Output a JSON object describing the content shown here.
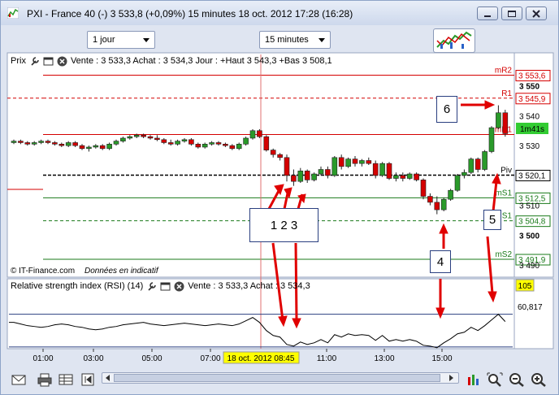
{
  "window": {
    "title": "PXI - France 40 (-)   3 533,8 (+0,09%)   15 minutes   18 oct. 2012 17:28 (16:28)"
  },
  "toolbar": {
    "period_select": "1 jour",
    "interval_select": "15 minutes"
  },
  "price_panel": {
    "name": "Prix",
    "info": "Vente : 3 533,3 Achat : 3 534,3 Jour : +Haut 3 543,3 +Bas 3 508,1",
    "copyright": "© IT-Finance.com",
    "disclaimer": "Données en indicatif",
    "timer": "1m41s"
  },
  "rsi_panel": {
    "name": "Relative strength index (RSI) (14)",
    "info": "Vente : 3 533,3 Achat : 3 534,3",
    "top_tag": "105",
    "value_label": "60,817"
  },
  "x_axis": {
    "labels": [
      "01:00",
      "03:00",
      "05:00",
      "07:00",
      "11:00",
      "13:00",
      "15:00"
    ],
    "cursor_label": "18 oct. 2012 08:45"
  },
  "annotations": {
    "box_123": "1 2 3",
    "box_4": "4",
    "box_5": "5",
    "box_6": "6"
  },
  "chart_data": {
    "type": "candlestick",
    "y_range": [
      3487,
      3560
    ],
    "y_ticks": [
      {
        "value": 3550,
        "label": "3 550",
        "bold": true
      },
      {
        "value": 3540,
        "label": "3 540",
        "bold": false
      },
      {
        "value": 3530,
        "label": "3 530",
        "bold": false
      },
      {
        "value": 3510,
        "label": "3 510",
        "bold": false
      },
      {
        "value": 3500,
        "label": "3 500",
        "bold": true
      },
      {
        "value": 3490,
        "label": "3 490",
        "bold": false
      }
    ],
    "levels": [
      {
        "name": "mR2",
        "value": 3553.6,
        "label": "3 553,6",
        "color": "#d40000",
        "style": "solid"
      },
      {
        "name": "R1",
        "value": 3545.9,
        "label": "3 545,9",
        "color": "#d40000",
        "style": "dashed"
      },
      {
        "name": "mR1",
        "value": 3533.7,
        "label": "",
        "color": "#d40000",
        "style": "solid"
      },
      {
        "name": "Piv",
        "value": 3520.1,
        "label": "3 520,1",
        "color": "#000000",
        "style": "dashed"
      },
      {
        "name": "mS1",
        "value": 3512.5,
        "label": "3 512,5",
        "color": "#1a7a1a",
        "style": "solid"
      },
      {
        "name": "S1",
        "value": 3504.8,
        "label": "3 504,8",
        "color": "#1a7a1a",
        "style": "dashed"
      },
      {
        "name": "mS2",
        "value": 3491.9,
        "label": "3 491,9",
        "color": "#1a7a1a",
        "style": "solid"
      }
    ],
    "current_price": 3533.3,
    "candles": [
      [
        3531,
        3532,
        3530.5,
        3531.5
      ],
      [
        3531.5,
        3532,
        3530.5,
        3531
      ],
      [
        3531,
        3531.5,
        3530,
        3530.5
      ],
      [
        3530.5,
        3531.5,
        3530,
        3531
      ],
      [
        3531,
        3532,
        3530.5,
        3531.5
      ],
      [
        3531.5,
        3532,
        3530.5,
        3531
      ],
      [
        3531,
        3531.5,
        3530,
        3530.5
      ],
      [
        3530.5,
        3531,
        3529.5,
        3530
      ],
      [
        3530,
        3531.5,
        3529.5,
        3531
      ],
      [
        3531,
        3531.5,
        3529.5,
        3530
      ],
      [
        3530,
        3530.5,
        3528.5,
        3529
      ],
      [
        3529,
        3530,
        3528,
        3529.5
      ],
      [
        3529.5,
        3530.5,
        3529,
        3530
      ],
      [
        3530,
        3530.5,
        3528.5,
        3529
      ],
      [
        3529,
        3531,
        3528.5,
        3530.5
      ],
      [
        3530.5,
        3532,
        3530,
        3531.5
      ],
      [
        3531.5,
        3533,
        3531,
        3532.5
      ],
      [
        3532.5,
        3533.5,
        3532,
        3533
      ],
      [
        3533,
        3534,
        3532.5,
        3533.5
      ],
      [
        3533.5,
        3534,
        3532.5,
        3533
      ],
      [
        3533,
        3533.5,
        3532,
        3532.5
      ],
      [
        3532.5,
        3533.5,
        3531.5,
        3532
      ],
      [
        3532,
        3532.5,
        3530.5,
        3531
      ],
      [
        3531,
        3532,
        3530,
        3530.5
      ],
      [
        3530.5,
        3532,
        3530,
        3531.5
      ],
      [
        3531.5,
        3532.5,
        3531,
        3532
      ],
      [
        3532,
        3532.5,
        3530,
        3530.5
      ],
      [
        3530.5,
        3531,
        3529,
        3529.5
      ],
      [
        3529.5,
        3531,
        3529,
        3530.5
      ],
      [
        3530.5,
        3531.5,
        3530,
        3531
      ],
      [
        3531,
        3531.5,
        3530,
        3530.5
      ],
      [
        3530.5,
        3531,
        3529.5,
        3530
      ],
      [
        3530,
        3530.5,
        3528.5,
        3529
      ],
      [
        3529,
        3531,
        3528.5,
        3530.5
      ],
      [
        3530.5,
        3533,
        3530,
        3532.5
      ],
      [
        3532.5,
        3535.5,
        3532,
        3535
      ],
      [
        3535,
        3535.5,
        3532.5,
        3533
      ],
      [
        3533,
        3533.5,
        3528,
        3528.5
      ],
      [
        3528.5,
        3529,
        3526,
        3527
      ],
      [
        3527,
        3527.5,
        3525,
        3526
      ],
      [
        3526,
        3527,
        3518,
        3520
      ],
      [
        3520,
        3522,
        3516.5,
        3518
      ],
      [
        3518,
        3522.5,
        3517.5,
        3521.5
      ],
      [
        3521.5,
        3522,
        3517.5,
        3518.5
      ],
      [
        3518.5,
        3521,
        3518,
        3520.5
      ],
      [
        3520.5,
        3523,
        3520,
        3522
      ],
      [
        3522,
        3523,
        3519,
        3520
      ],
      [
        3520,
        3526.5,
        3519.5,
        3526
      ],
      [
        3526,
        3527,
        3522,
        3523
      ],
      [
        3523,
        3526,
        3522.5,
        3525.5
      ],
      [
        3525.5,
        3526.5,
        3523,
        3524
      ],
      [
        3524,
        3525.5,
        3523,
        3525
      ],
      [
        3525,
        3526,
        3523.5,
        3524
      ],
      [
        3524,
        3525,
        3519,
        3520
      ],
      [
        3520,
        3524.5,
        3519.5,
        3524
      ],
      [
        3524,
        3524.5,
        3518.5,
        3519
      ],
      [
        3519,
        3521,
        3518,
        3520
      ],
      [
        3520,
        3521,
        3518,
        3519
      ],
      [
        3519,
        3521,
        3518.5,
        3520.5
      ],
      [
        3520.5,
        3521,
        3518,
        3518.5
      ],
      [
        3518.5,
        3519,
        3512,
        3513
      ],
      [
        3513,
        3514,
        3510,
        3511
      ],
      [
        3511,
        3513,
        3507,
        3508.5
      ],
      [
        3508.5,
        3512.5,
        3508,
        3512
      ],
      [
        3512,
        3515.5,
        3511.5,
        3515
      ],
      [
        3515,
        3520.5,
        3514.5,
        3520
      ],
      [
        3520,
        3522,
        3519,
        3521
      ],
      [
        3521,
        3526,
        3520.5,
        3525.5
      ],
      [
        3525.5,
        3526,
        3521,
        3522
      ],
      [
        3522,
        3528.5,
        3521.5,
        3528
      ],
      [
        3528,
        3536.5,
        3527.5,
        3536
      ],
      [
        3536,
        3543.5,
        3535.5,
        3541
      ],
      [
        3541,
        3542,
        3533,
        3534
      ]
    ],
    "rsi": {
      "range": [
        0,
        105
      ],
      "upper_band": 70,
      "lower_band": 30,
      "current": 60.817,
      "values": [
        60,
        58,
        56,
        55,
        54,
        55,
        57,
        58,
        57,
        55,
        54,
        52,
        51,
        52,
        54,
        55,
        57,
        58,
        59,
        60,
        58,
        57,
        56,
        57,
        58,
        59,
        58,
        57,
        56,
        57,
        58,
        57,
        56,
        58,
        62,
        66,
        60,
        50,
        44,
        42,
        33,
        31,
        36,
        33,
        35,
        39,
        35,
        45,
        42,
        46,
        44,
        45,
        44,
        38,
        44,
        37,
        39,
        37,
        39,
        37,
        32,
        31,
        29,
        35,
        40,
        46,
        48,
        54,
        50,
        56,
        63,
        70,
        61
      ]
    }
  }
}
